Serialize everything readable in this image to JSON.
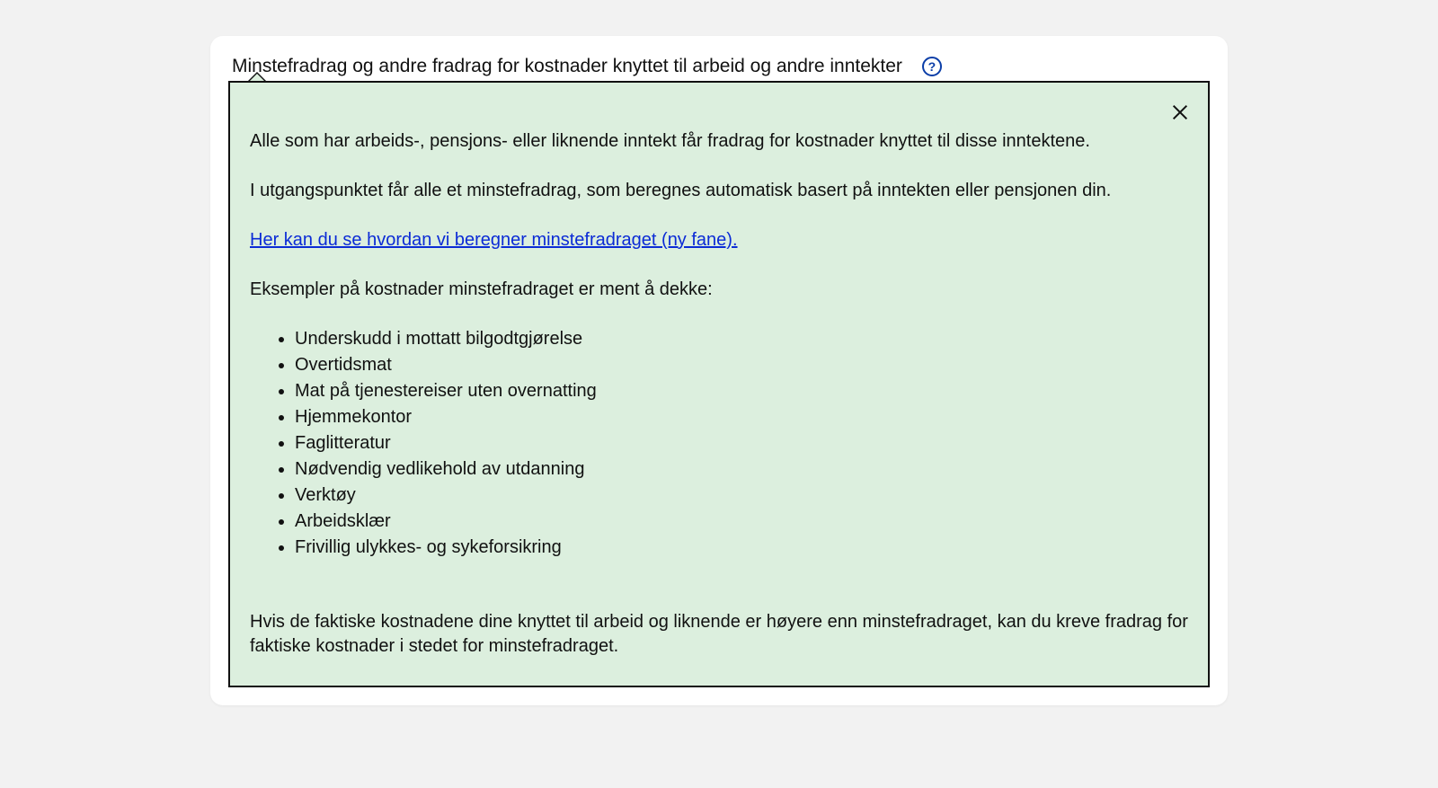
{
  "card": {
    "title": "Minstefradrag og andre fradrag for kostnader knyttet til arbeid og andre inntekter"
  },
  "popup": {
    "intro1": "Alle som har arbeids-, pensjons- eller liknende inntekt får fradrag for kostnader knyttet til disse inntektene.",
    "intro2": "I utgangspunktet får alle et minstefradrag, som beregnes automatisk basert på inntekten eller pensjonen din.",
    "link_text": "Her kan du se hvordan vi beregner minstefradraget (ny fane).",
    "examples_heading": "Eksempler på kostnader minstefradraget er ment å dekke:",
    "examples": [
      "Underskudd i mottatt bilgodtgjørelse",
      "Overtidsmat",
      "Mat på tjenestereiser uten overnatting",
      "Hjemmekontor",
      "Faglitteratur",
      "Nødvendig vedlikehold av utdanning",
      "Verktøy",
      "Arbeidsklær",
      "Frivillig ulykkes- og sykeforsikring"
    ],
    "outro": "Hvis de faktiske kostnadene dine knyttet til arbeid og liknende er høyere enn minstefradraget, kan du kreve fradrag for faktiske kostnader i stedet for minstefradraget."
  }
}
